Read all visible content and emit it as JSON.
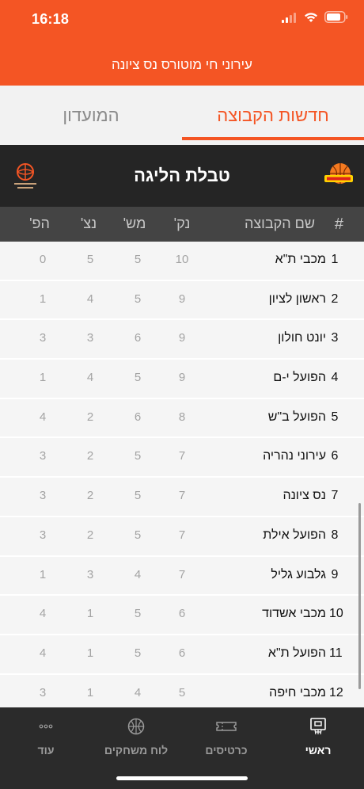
{
  "status_bar": {
    "time": "16:18"
  },
  "header": {
    "title": "עירוני חי מוטורס נס ציונה"
  },
  "tabs": [
    {
      "label": "חדשות הקבוצה",
      "active": true
    },
    {
      "label": "המועדון",
      "active": false
    }
  ],
  "league": {
    "title": "טבלת הליגה"
  },
  "table": {
    "columns": {
      "rank": "#",
      "team": "שם הקבוצה",
      "points": "נק'",
      "games": "מש'",
      "wins": "נצ'",
      "losses": "הפ'"
    },
    "rows": [
      {
        "rank": "1",
        "team": "מכבי ת\"א",
        "points": "10",
        "games": "5",
        "wins": "5",
        "losses": "0"
      },
      {
        "rank": "2",
        "team": "ראשון לציון",
        "points": "9",
        "games": "5",
        "wins": "4",
        "losses": "1"
      },
      {
        "rank": "3",
        "team": "יונט חולון",
        "points": "9",
        "games": "6",
        "wins": "3",
        "losses": "3"
      },
      {
        "rank": "4",
        "team": "הפועל י-ם",
        "points": "9",
        "games": "5",
        "wins": "4",
        "losses": "1"
      },
      {
        "rank": "5",
        "team": "הפועל ב\"ש",
        "points": "8",
        "games": "6",
        "wins": "2",
        "losses": "4"
      },
      {
        "rank": "6",
        "team": "עירוני נהריה",
        "points": "7",
        "games": "5",
        "wins": "2",
        "losses": "3"
      },
      {
        "rank": "7",
        "team": "נס ציונה",
        "points": "7",
        "games": "5",
        "wins": "2",
        "losses": "3"
      },
      {
        "rank": "8",
        "team": "הפועל אילת",
        "points": "7",
        "games": "5",
        "wins": "2",
        "losses": "3"
      },
      {
        "rank": "9",
        "team": "גלבוע גליל",
        "points": "7",
        "games": "4",
        "wins": "3",
        "losses": "1"
      },
      {
        "rank": "10",
        "team": "מכבי אשדוד",
        "points": "6",
        "games": "5",
        "wins": "1",
        "losses": "4"
      },
      {
        "rank": "11",
        "team": "הפועל ת\"א",
        "points": "6",
        "games": "5",
        "wins": "1",
        "losses": "4"
      },
      {
        "rank": "12",
        "team": "מכבי חיפה",
        "points": "5",
        "games": "4",
        "wins": "1",
        "losses": "3"
      }
    ]
  },
  "bottom_nav": [
    {
      "label": "ראשי",
      "icon": "home-icon",
      "active": true
    },
    {
      "label": "כרטיסים",
      "icon": "ticket-icon",
      "active": false
    },
    {
      "label": "לוח משחקים",
      "icon": "basketball-icon",
      "active": false
    },
    {
      "label": "עוד",
      "icon": "more-icon",
      "active": false
    }
  ],
  "colors": {
    "accent": "#f45524",
    "dark_bar": "#252525",
    "header_row": "#444444",
    "nav_bg": "#2b2b2b"
  }
}
